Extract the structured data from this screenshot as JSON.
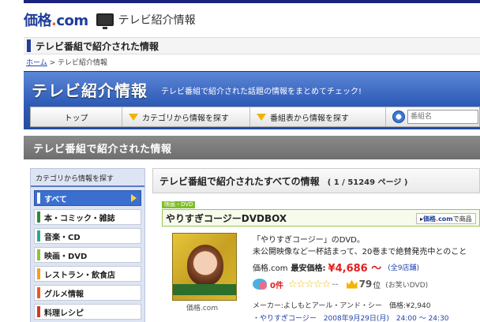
{
  "header": {
    "logo_main": "価格",
    "logo_dot": ".",
    "logo_tld": "com",
    "title": "テレビ紹介情報"
  },
  "section_title": "テレビ番組で紹介された情報",
  "breadcrumb": {
    "home": "ホーム",
    "separator": ">",
    "current": "テレビ紹介情報"
  },
  "banner": {
    "title": "テレビ紹介情報",
    "subtitle": "テレビ番組で紹介された話題の情報をまとめてチェック!"
  },
  "nav": {
    "top": "トップ",
    "category": "カテゴリから情報を探す",
    "tv_schedule": "番組表から情報を探す",
    "search_placeholder": "番組名"
  },
  "gray_band_title": "テレビ番組で紹介された情報",
  "sidebar": {
    "heading": "カテゴリから情報を探す",
    "items": [
      {
        "label": "すべて",
        "color": "#ffffff"
      },
      {
        "label": "本・コミック・雑誌",
        "color": "#2e8b3a"
      },
      {
        "label": "音楽・CD",
        "color": "#2aa89a"
      },
      {
        "label": "映画・DVD",
        "color": "#8cc43a"
      },
      {
        "label": "レストラン・飲食店",
        "color": "#f0a020"
      },
      {
        "label": "グルメ情報",
        "color": "#e85a2a"
      },
      {
        "label": "料理レシピ",
        "color": "#d23a2a"
      }
    ]
  },
  "main": {
    "heading": "テレビ番組で紹介されたすべての情報",
    "paging": "( 1 / 51249 ページ )",
    "product": {
      "genre": "映画・DVD",
      "title": "やりすぎコージーDVDBOX",
      "kakaku_link_logo_main": "価格",
      "kakaku_link_logo_dot": ".",
      "kakaku_link_logo_tld": "com",
      "kakaku_link_text": "で商品",
      "image_caption": "価格.com",
      "desc_line1": "「やりすぎコージー」のDVD。",
      "desc_line2": "未公開映像など一杯詰まって、20巻まで絶賛発売中とのこと",
      "price_site": "価格.com",
      "price_label": "最安価格:",
      "price": "¥4,686 〜",
      "shops": "(全9店舗)",
      "review_count": "0件",
      "stars": "☆☆☆☆☆",
      "rating": "--",
      "rank": "79",
      "rank_suffix": "位",
      "rank_category": "(お笑いDVD)",
      "maker": "メーカー:よしもとアール・アンド・シー　価格:¥2,940",
      "date_line": "・やりすぎコージー　2008年9月29日(月)　24:00 ～ 24:30"
    }
  }
}
